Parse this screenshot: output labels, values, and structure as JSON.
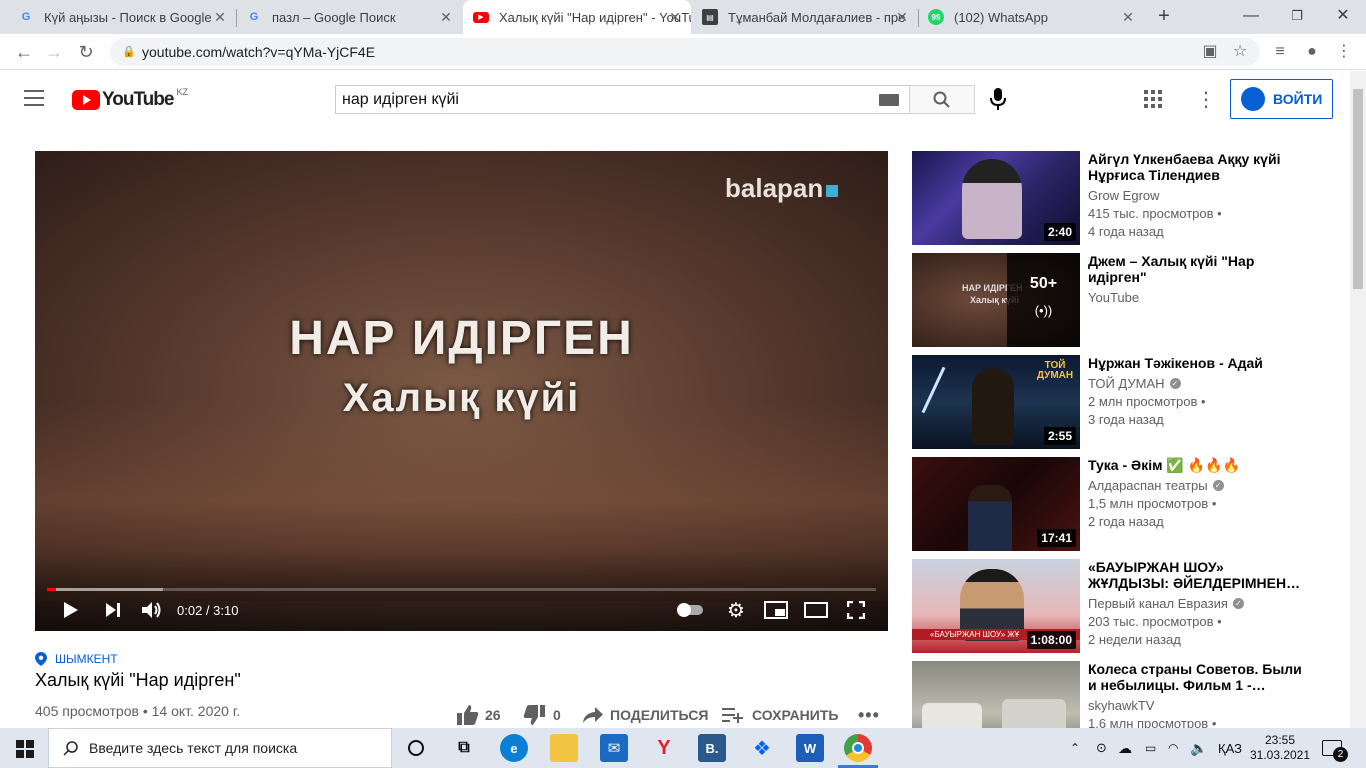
{
  "browser": {
    "tabs": [
      {
        "title": "Күй аңызы - Поиск в Google",
        "favicon": "G",
        "active": false
      },
      {
        "title": "пазл – Google Поиск",
        "favicon": "G",
        "active": false
      },
      {
        "title": "Халық күйі \"Нар идірген\" - YouTube",
        "favicon": "yt",
        "active": true
      },
      {
        "title": "Тұманбай Молдағалиев - пре",
        "favicon": "doc",
        "active": false
      },
      {
        "title": "(102) WhatsApp",
        "favicon": "wa",
        "active": false
      }
    ],
    "new_tab": "+",
    "url": "youtube.com/watch?v=qYMa-YjCF4E"
  },
  "youtube": {
    "logo_text": "YouTube",
    "region": "KZ",
    "search_value": "нар идірген күйі",
    "signin_label": "ВОЙТИ"
  },
  "player": {
    "brand": "balapan",
    "overlay_line1": "НАР ИДІРГЕН",
    "overlay_line2": "Халық күйі",
    "time": "0:02 / 3:10",
    "played_fraction": 0.0106,
    "loaded_fraction": 0.14
  },
  "video": {
    "location": "ШЫМКЕНТ",
    "title": "Халық күйі \"Нар идірген\"",
    "views": "405 просмотров",
    "date": "14 окт. 2020 г.",
    "likes": "26",
    "dislikes": "0",
    "share": "ПОДЕЛИТЬСЯ",
    "save": "СОХРАНИТЬ"
  },
  "recommendations": [
    {
      "title": "Айгүл Үлкенбаева Аққу күйі Нұрғиса Тілендиев",
      "channel": "Grow Egrow",
      "verified": false,
      "views": "415 тыс. просмотров",
      "age": "4 года назад",
      "duration": "2:40"
    },
    {
      "title": "Джем – Халық күйі \"Нар идірген\"",
      "channel": "YouTube",
      "verified": false,
      "views": "",
      "age": "",
      "duration": "",
      "mix_count": "50+",
      "thumb_line1": "НАР ИДІРГЕН",
      "thumb_line2": "Халық күйі"
    },
    {
      "title": "Нұржан Тәжікенов - Адай",
      "channel": "ТОЙ ДУМАН",
      "verified": true,
      "views": "2 млн просмотров",
      "age": "3 года назад",
      "duration": "2:55",
      "thumb_logo": "ТОЙ ДУМАН"
    },
    {
      "title": "Тука - Әкім ✅ 🔥🔥🔥",
      "channel": "Алдараспан театры",
      "verified": true,
      "views": "1,5 млн просмотров",
      "age": "2 года назад",
      "duration": "17:41"
    },
    {
      "title": "«БАУЫРЖАН ШОУ» ЖҰЛДЫЗЫ: ӘЙЕЛДЕРІМНЕН…",
      "channel": "Первый канал Евразия",
      "verified": true,
      "views": "203 тыс. просмотров",
      "age": "2 недели назад",
      "duration": "1:08:00",
      "thumb_caption": "«БАУЫРЖАН ШОУ» ЖҰ"
    },
    {
      "title": "Колеса страны Советов. Были и небылицы. Фильм 1 -…",
      "channel": "skyhawkTV",
      "verified": false,
      "views": "1,6 млн просмотров",
      "age": "",
      "duration": ""
    }
  ],
  "taskbar": {
    "search_placeholder": "Введите здесь текст для поиска",
    "language": "ҚАЗ",
    "time": "23:55",
    "date": "31.03.2021",
    "notifications": "2"
  },
  "colors": {
    "youtube_red": "#ff0000",
    "link_blue": "#065fd4",
    "tabstrip": "#dee1e6",
    "taskbar": "#dfe6ef"
  }
}
